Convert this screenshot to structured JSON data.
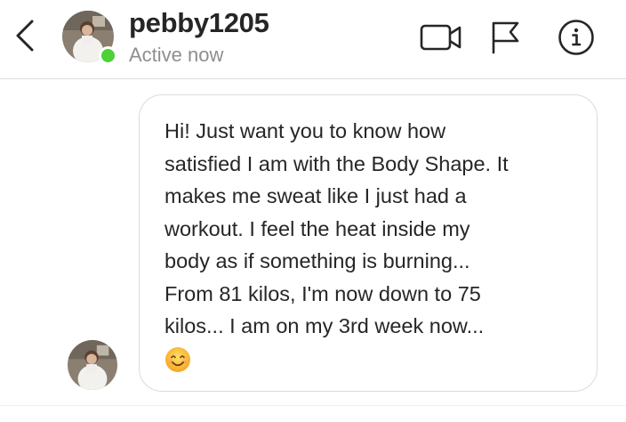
{
  "header": {
    "username": "pebby1205",
    "status": "Active now",
    "icons": [
      "back-chevron-icon",
      "video-camera-icon",
      "flag-icon",
      "info-icon"
    ]
  },
  "colors": {
    "online": "#4cd137",
    "text": "#262626",
    "muted": "#8e8e8e",
    "border": "#dbdbdb"
  },
  "message": {
    "text": "Hi! Just want you to know how\nsatisfied I am with the Body Shape. It\nmakes me sweat like I just had a\nworkout. I feel the heat inside my\nbody as if something is burning...\nFrom 81 kilos, I'm now down to 75\nkilos... I am on my 3rd week now...",
    "emoji": "smiling-face-emoji"
  }
}
